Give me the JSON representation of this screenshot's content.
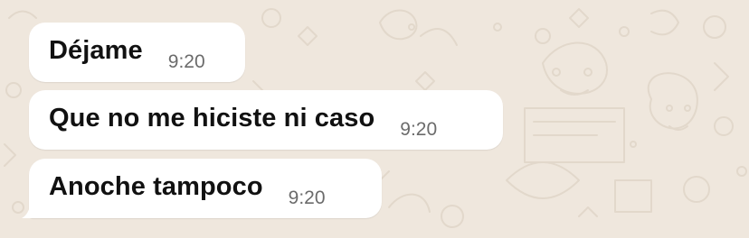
{
  "conversation": {
    "messages": [
      {
        "text": "Déjame",
        "time": "9:20"
      },
      {
        "text": "Que no me hiciste ni caso",
        "time": "9:20"
      },
      {
        "text": "Anoche tampoco",
        "time": "9:20"
      }
    ]
  },
  "colors": {
    "wallpaper": "#efe7dd",
    "bubble": "#ffffff",
    "message_text": "#111111",
    "timestamp": "#6b6b6b"
  }
}
